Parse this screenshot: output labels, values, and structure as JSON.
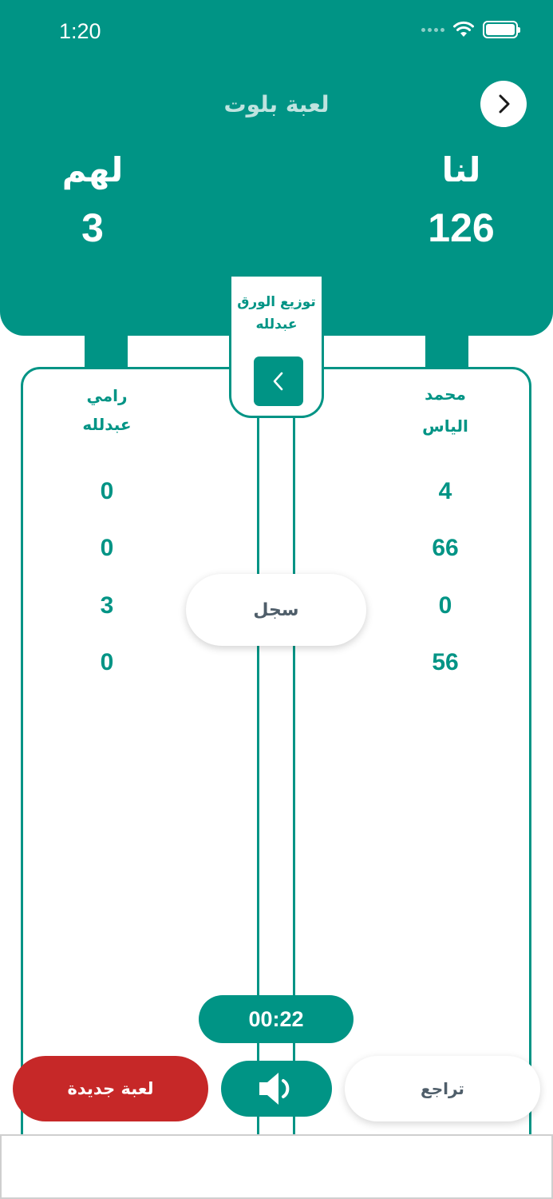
{
  "theme": {
    "teal": "#009485",
    "red": "#c62828"
  },
  "status_bar": {
    "time": "1:20",
    "icons": [
      "cellular-dots-icon",
      "wifi-icon",
      "battery-icon"
    ]
  },
  "header": {
    "title": "لعبة بلوت",
    "nav_icon": "chevron-right-icon",
    "teams": [
      {
        "label": "لنا",
        "score": "126"
      },
      {
        "label": "لهم",
        "score": "3"
      }
    ]
  },
  "dealer": {
    "title": "توزيع الورق",
    "name": "عبدلله",
    "next_icon": "chevron-left-icon"
  },
  "players": {
    "right": {
      "first": "محمد",
      "last": "الياس"
    },
    "left": {
      "first": "رامي",
      "last": "عبدلله"
    }
  },
  "rounds": {
    "right": [
      "4",
      "66",
      "0",
      "56"
    ],
    "left": [
      "0",
      "0",
      "3",
      "0"
    ]
  },
  "record_button": "سجل",
  "timer": "00:22",
  "buttons": {
    "new_game": "لعبة جديدة",
    "undo": "تراجع",
    "sound_icon": "speaker-icon"
  }
}
